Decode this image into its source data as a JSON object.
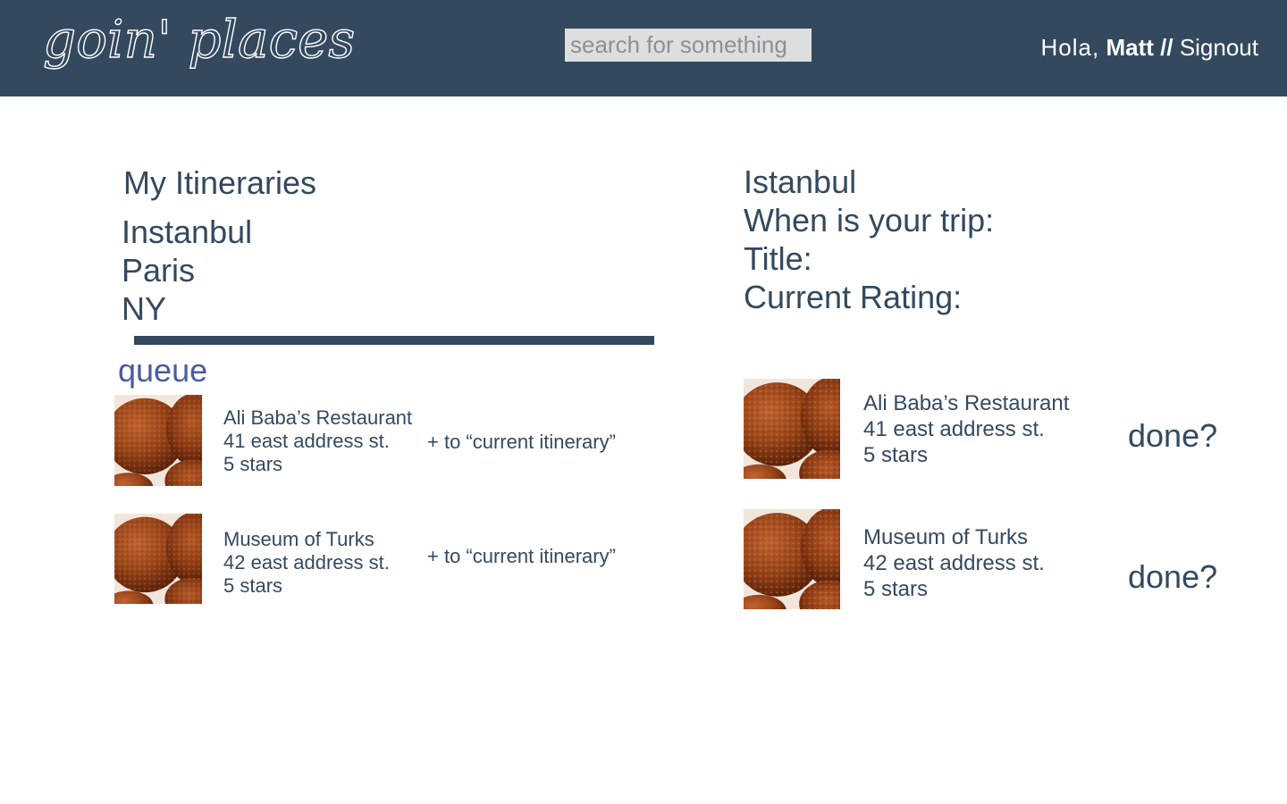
{
  "header": {
    "logo_text": "goin' places",
    "search_placeholder": "search for something",
    "greeting": "Hola,",
    "username": "Matt",
    "separator": "//",
    "signout_label": "Signout"
  },
  "itineraries": {
    "title": "My Itineraries",
    "items": [
      "Instanbul",
      "Paris",
      "NY"
    ]
  },
  "queue": {
    "label": "queue",
    "items": [
      {
        "name": "Ali Baba’s Restaurant",
        "address": "41 east address st.",
        "rating": "5 stars",
        "add_label": "+ to “current itinerary”",
        "image": "falafel-photo"
      },
      {
        "name": "Museum of Turks",
        "address": "42 east address st.",
        "rating": "5 stars",
        "add_label": "+ to “current itinerary”",
        "image": "falafel-photo"
      }
    ]
  },
  "current_itinerary": {
    "title": "Istanbul",
    "when_label": "When is your trip:",
    "title_label": "Title:",
    "rating_label": "Current Rating:",
    "items": [
      {
        "name": "Ali Baba’s Restaurant",
        "address": "41 east address st.",
        "rating": "5 stars",
        "done_label": "done?",
        "image": "falafel-photo"
      },
      {
        "name": "Museum of Turks",
        "address": "42 east address st.",
        "rating": "5 stars",
        "done_label": "done?",
        "image": "falafel-photo"
      }
    ]
  },
  "colors": {
    "header_bg": "#34495e",
    "text": "#34495e",
    "queue_label": "#4a5ba0",
    "search_bg": "#dcdee0"
  }
}
